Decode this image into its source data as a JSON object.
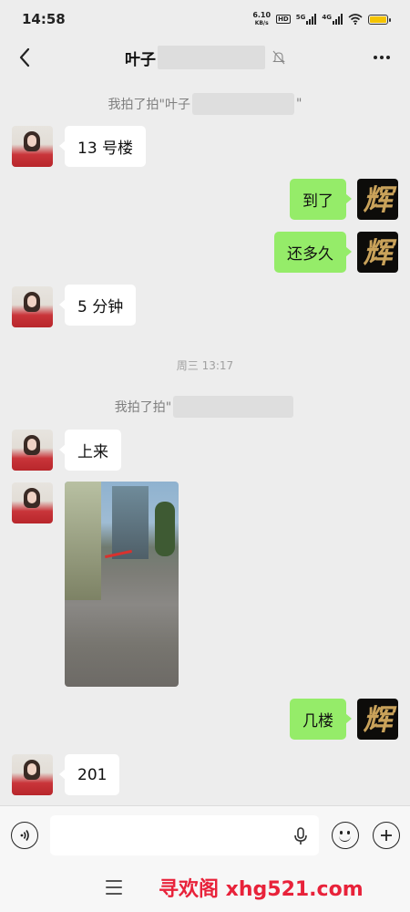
{
  "status_bar": {
    "time": "14:58",
    "net_speed_value": "6.10",
    "net_speed_unit": "KB/s",
    "hd_badge": "HD",
    "sim1_label": "5G",
    "sim2_label": "4G"
  },
  "header": {
    "title": "叶子",
    "back_icon": "chevron-left-icon",
    "mute_icon": "bell-off-icon",
    "more_icon": "more-icon"
  },
  "messages": {
    "sys_1_prefix": "我拍了拍\"叶子",
    "sys_1_suffix": "\"",
    "m1_text": "13 号楼",
    "m2_text": "到了",
    "m3_text": "还多久",
    "m4_text": "5 分钟",
    "time_divider": "周三 13:17",
    "sys_2_prefix": "我拍了拍\"",
    "m5_text": "上来",
    "m7_text": "几楼",
    "m8_text": "201",
    "right_avatar_glyph": "辉"
  },
  "input_bar": {
    "voice_icon": "voice-icon",
    "mic_icon": "microphone-icon",
    "emoji_icon": "emoji-icon",
    "plus_icon": "plus-icon"
  },
  "nav_bar": {
    "menu_icon": "menu-icon",
    "watermark": "寻欢阁 xhg521.com"
  },
  "colors": {
    "background": "#ededed",
    "sent_bubble": "#95ec69",
    "received_bubble": "#ffffff",
    "watermark": "#e8223a"
  }
}
